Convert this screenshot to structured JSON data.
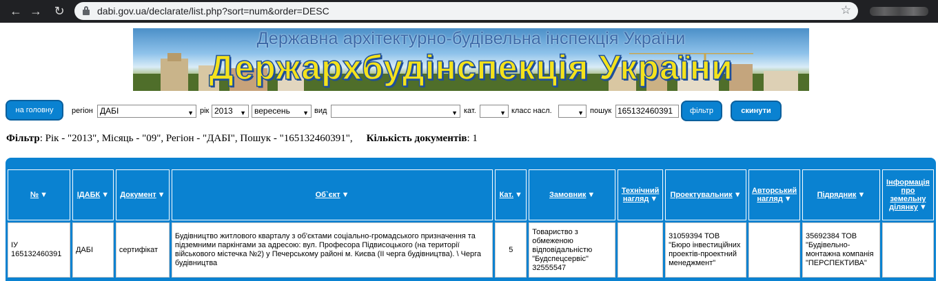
{
  "browser": {
    "url": "dabi.gov.ua/declarate/list.php?sort=num&order=DESC"
  },
  "banner": {
    "subtitle": "Державна архітектурно-будівельна інспекція України",
    "title": "Держархбудінспекція України"
  },
  "form": {
    "home_button": "на головну",
    "region_label": "регіон",
    "region_value": "ДАБІ",
    "year_label": "рік",
    "year_value": "2013",
    "month_value": "вересень",
    "type_label": "вид",
    "type_value": "",
    "category_label": "кат.",
    "category_value": "",
    "class_label": "класс насл.",
    "class_value": "",
    "search_label": "пошук",
    "search_value": "165132460391",
    "filter_button": "фільтр",
    "reset_button": "скинути"
  },
  "summary": {
    "filter_label": "Фільтр",
    "filter_text": ": Рік - \"2013\", Місяць - \"09\", Регіон - \"ДАБІ\", Пошук - \"165132460391\",",
    "count_label": "Кількість документів",
    "count_text": ": 1"
  },
  "table": {
    "columns": [
      {
        "label": "№"
      },
      {
        "label": "ІДАБК"
      },
      {
        "label": "Документ"
      },
      {
        "label": "Об`єкт"
      },
      {
        "label": "Кат."
      },
      {
        "label": "Замовник"
      },
      {
        "label": "Технічний нагляд"
      },
      {
        "label": "Проектувальник"
      },
      {
        "label": "Авторський нагляд"
      },
      {
        "label": "Підрядник"
      },
      {
        "label": "Інформація про земельну ділянку"
      }
    ],
    "rows": [
      {
        "num": "ІУ 165132460391",
        "idabk": "ДАБІ",
        "document": "сертифікат",
        "object": "Будівництво житлового кварталу з об'єктами соціально-громадського призначення та підземними паркінгами за адресою: вул. Професора Підвисоцького (на території військового містечка №2) у Печерському районі м. Києва (ІІ черга будівництва). \\ Черга будівництва",
        "category": "5",
        "customer": "Товариство з обмеженою відповідальністю \"Будспецсервіс\" 32555547",
        "tech_supervision": "",
        "designer": "31059394 ТОВ \"Бюро інвестиційних проектів-проектний менеджмент\"",
        "author_supervision": "",
        "contractor": "35692384 ТОВ \"Будівельно-монтажна компанія \"ПЕРСПЕКТИВА\"",
        "land_info": ""
      }
    ]
  }
}
